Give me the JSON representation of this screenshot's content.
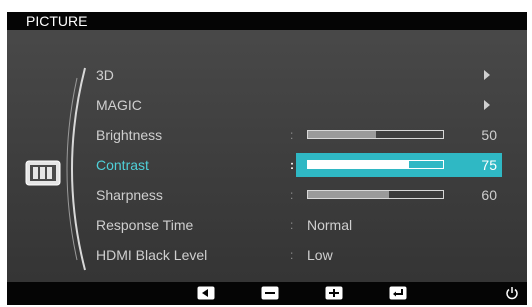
{
  "title": "PICTURE",
  "menu": [
    {
      "label": "3D",
      "type": "submenu"
    },
    {
      "label": "MAGIC",
      "type": "submenu"
    },
    {
      "label": "Brightness",
      "type": "slider",
      "value": "50",
      "level": 50
    },
    {
      "label": "Contrast",
      "type": "slider",
      "value": "75",
      "level": 75,
      "selected": true
    },
    {
      "label": "Sharpness",
      "type": "slider",
      "value": "60",
      "level": 60
    },
    {
      "label": "Response Time",
      "type": "option",
      "value": "Normal"
    },
    {
      "label": "HDMI Black Level",
      "type": "option",
      "value": "Low"
    }
  ],
  "separator": ":",
  "colors": {
    "accent": "#2fb8c4",
    "selected_text": "#4fd0d8"
  },
  "section_icon": "picture-section-icon",
  "buttons": [
    "left-arrow-icon",
    "minus-icon",
    "plus-icon",
    "enter-icon",
    "power-icon"
  ]
}
